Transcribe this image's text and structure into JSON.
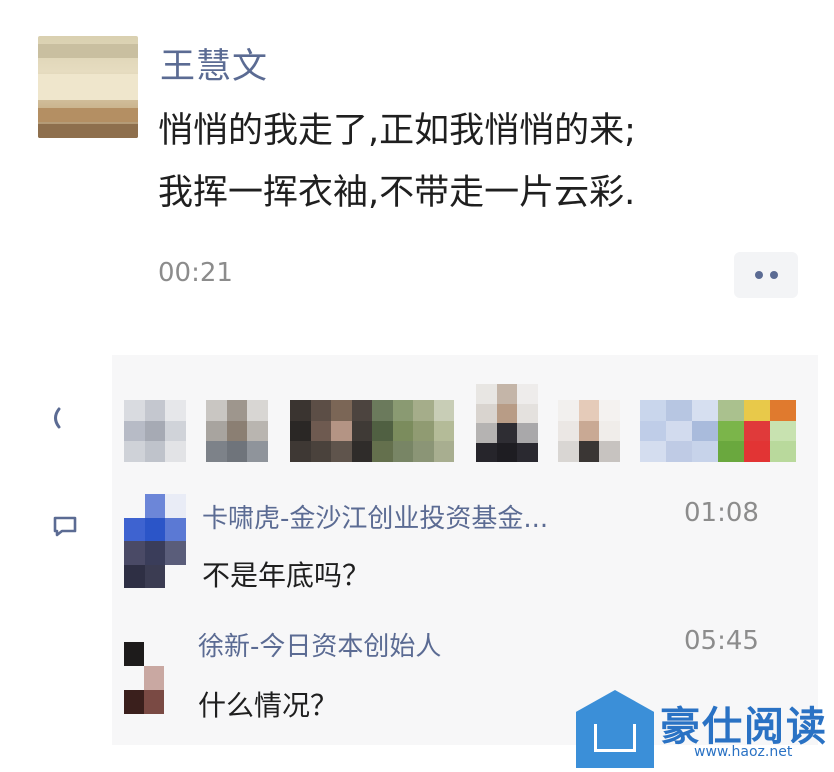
{
  "post": {
    "author": "王慧文",
    "text_line1": "悄悄的我走了,正如我悄悄的来;",
    "text_line2": "我挥一挥衣袖,不带走一片云彩.",
    "time": "00:21",
    "more_icon": "more-dots-icon"
  },
  "interactions": {
    "like_icon": "like-icon",
    "comment_icon": "comment-icon",
    "comments": [
      {
        "name": "卡啸虎-金沙江创业投资基金...",
        "time": "01:08",
        "text": "不是年底吗？"
      },
      {
        "name": "徐新-今日资本创始人",
        "time": "05:45",
        "text": "什么情况？"
      }
    ]
  },
  "watermark": {
    "brand": "豪仕阅读",
    "url": "www.haoz.net"
  },
  "colors": {
    "name_link": "#5b6b93",
    "text": "#1f1f1f",
    "muted": "#8c8c8c",
    "panel_bg": "#f7f7f8",
    "watermark": "#2a72c4"
  }
}
